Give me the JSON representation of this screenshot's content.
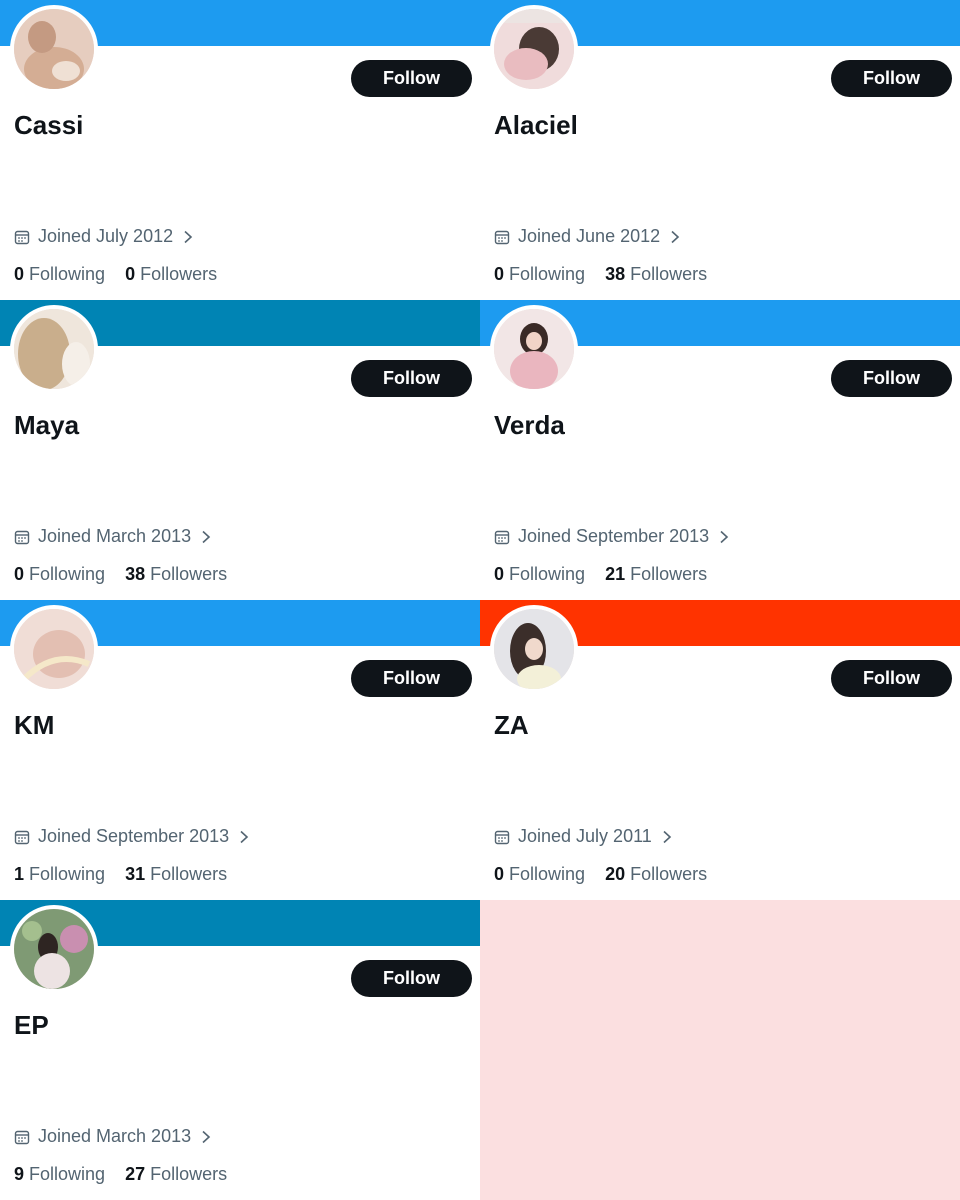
{
  "follow_label": "Follow",
  "following_label": "Following",
  "followers_label": "Followers",
  "cards": [
    {
      "name": "Cassi",
      "joined": "Joined July 2012",
      "following": "0",
      "followers": "0",
      "banner_color": "#1d9bf0",
      "avatar_tint": "#d8b7a6"
    },
    {
      "name": "Alaciel",
      "joined": "Joined June 2012",
      "following": "0",
      "followers": "38",
      "banner_color": "#1d9bf0",
      "avatar_tint": "#e7c3c4"
    },
    {
      "name": "Maya",
      "joined": "Joined March 2013",
      "following": "0",
      "followers": "38",
      "banner_color": "#0084b4",
      "avatar_tint": "#d9c8b3"
    },
    {
      "name": "Verda",
      "joined": "Joined September 2013",
      "following": "0",
      "followers": "21",
      "banner_color": "#1d9bf0",
      "avatar_tint": "#e4c1c6"
    },
    {
      "name": "KM",
      "joined": "Joined September 2013",
      "following": "1",
      "followers": "31",
      "banner_color": "#1d9bf0",
      "avatar_tint": "#e8cbc2"
    },
    {
      "name": "ZA",
      "joined": "Joined July 2011",
      "following": "0",
      "followers": "20",
      "banner_color": "#ff3300",
      "avatar_tint": "#d7d4d0"
    },
    {
      "name": "EP",
      "joined": "Joined March 2013",
      "following": "9",
      "followers": "27",
      "banner_color": "#0084b4",
      "avatar_tint": "#9bb08f"
    }
  ],
  "empty_panel_color": "#fbdfe0"
}
